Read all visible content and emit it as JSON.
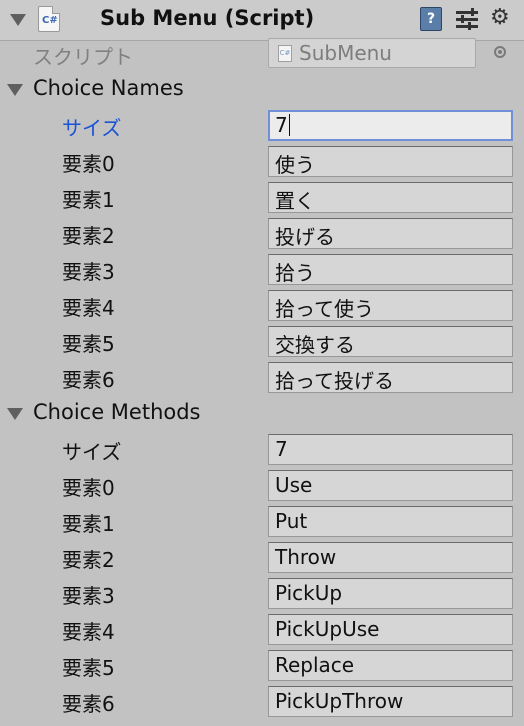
{
  "component": {
    "title": "Sub Menu (Script)",
    "icon": "csharp-script-icon",
    "cs_label": "C#",
    "actions": [
      "help-icon",
      "preset-icon",
      "gear-icon"
    ]
  },
  "script": {
    "label": "スクリプト",
    "value": "SubMenu",
    "mini_cs": "C#"
  },
  "arrays": [
    {
      "title": "Choice Names",
      "size_label": "サイズ",
      "size_value": "7",
      "elements": [
        {
          "label": "要素0",
          "value": "使う"
        },
        {
          "label": "要素1",
          "value": "置く"
        },
        {
          "label": "要素2",
          "value": "投げる"
        },
        {
          "label": "要素3",
          "value": "拾う"
        },
        {
          "label": "要素4",
          "value": "拾って使う"
        },
        {
          "label": "要素5",
          "value": "交換する"
        },
        {
          "label": "要素6",
          "value": "拾って投げる"
        }
      ]
    },
    {
      "title": "Choice Methods",
      "size_label": "サイズ",
      "size_value": "7",
      "elements": [
        {
          "label": "要素0",
          "value": "Use"
        },
        {
          "label": "要素1",
          "value": "Put"
        },
        {
          "label": "要素2",
          "value": "Throw"
        },
        {
          "label": "要素3",
          "value": "PickUp"
        },
        {
          "label": "要素4",
          "value": "PickUpUse"
        },
        {
          "label": "要素5",
          "value": "Replace"
        },
        {
          "label": "要素6",
          "value": "PickUpThrow"
        }
      ]
    }
  ],
  "colors": {
    "background": "#c2c2c2",
    "focused_label": "#1a52d6",
    "focused_border": "#6f8fd6"
  }
}
